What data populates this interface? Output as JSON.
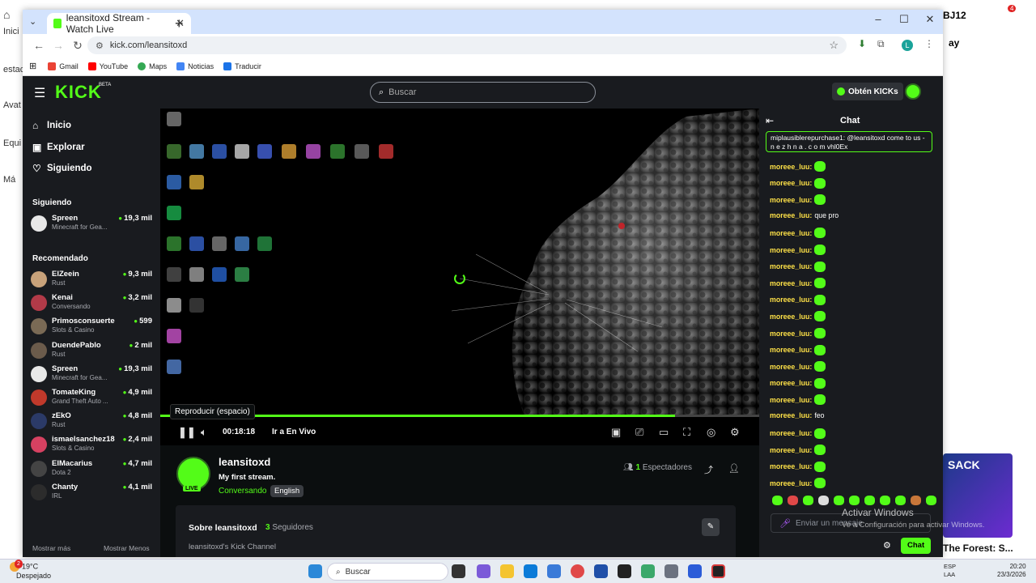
{
  "desktop": {
    "left_labels": [
      "Inici",
      "estac",
      "Avat",
      "Equi",
      "Má"
    ],
    "right_labels": [
      "BJ12",
      "ay"
    ],
    "notification_count": "4"
  },
  "browser": {
    "tab_title": "leansitoxd Stream - Watch Live",
    "url": "kick.com/leansitoxd",
    "bookmarks": [
      "Gmail",
      "YouTube",
      "Maps",
      "Noticias",
      "Traducir"
    ],
    "profile_letter": "L"
  },
  "kick": {
    "logo": "KICK",
    "beta": "BETA",
    "search_placeholder": "Buscar",
    "get_kicks": "Obtén KICKs",
    "nav": [
      "Inicio",
      "Explorar",
      "Siguiendo"
    ],
    "following_title": "Siguiendo",
    "following": [
      {
        "name": "Spreen",
        "category": "Minecraft for Gea...",
        "viewers": "19,3 mil"
      }
    ],
    "recommended_title": "Recomendado",
    "recommended": [
      {
        "name": "ElZeein",
        "category": "Rust",
        "viewers": "9,3 mil",
        "color": "#c8a27a"
      },
      {
        "name": "Kenai",
        "category": "Conversando",
        "viewers": "3,2 mil",
        "color": "#b23a48"
      },
      {
        "name": "Primosconsuerte",
        "category": "Slots & Casino",
        "viewers": "599",
        "color": "#7a6a55"
      },
      {
        "name": "DuendePablo",
        "category": "Rust",
        "viewers": "2 mil",
        "color": "#6b5b4b"
      },
      {
        "name": "Spreen",
        "category": "Minecraft for Gea...",
        "viewers": "19,3 mil",
        "color": "#e8e8e8"
      },
      {
        "name": "TomateKing",
        "category": "Grand Theft Auto ...",
        "viewers": "4,9 mil",
        "color": "#c0392b"
      },
      {
        "name": "zEkO",
        "category": "Rust",
        "viewers": "4,8 mil",
        "color": "#2b3a67"
      },
      {
        "name": "ismaelsanchez18",
        "category": "Slots & Casino",
        "viewers": "2,4 mil",
        "color": "#d64161"
      },
      {
        "name": "ElMacarius",
        "category": "Dota 2",
        "viewers": "4,7 mil",
        "color": "#444"
      },
      {
        "name": "Chanty",
        "category": "IRL",
        "viewers": "4,1 mil",
        "color": "#2c2c2c"
      }
    ],
    "show_more": "Mostrar más",
    "show_less": "Mostrar Menos"
  },
  "player": {
    "tooltip": "Reproducir (espacio)",
    "time": "00:18:18",
    "go_live": "Ir a En Vivo",
    "progress_fraction": 0.86
  },
  "channel": {
    "name": "leansitoxd",
    "live_badge": "LIVE",
    "title": "My first stream.",
    "category": "Conversando",
    "language": "English",
    "viewers_count": "1",
    "viewers_label": "Espectadores",
    "about_title": "Sobre leansitoxd",
    "followers_count": "3",
    "followers_label": "Seguidores",
    "description": "leansitoxd's Kick Channel"
  },
  "chat": {
    "title": "Chat",
    "pinned_text": "miplausiblerepurchase1: @leansitoxd come to us - n e z h n a . c o m vhl0Ex",
    "messages": [
      {
        "user": "moreee_luu:",
        "text": ""
      },
      {
        "user": "moreee_luu:",
        "text": ""
      },
      {
        "user": "moreee_luu:",
        "text": ""
      },
      {
        "user": "moreee_luu:",
        "text": "que pro"
      },
      {
        "user": "moreee_luu:",
        "text": ""
      },
      {
        "user": "moreee_luu:",
        "text": ""
      },
      {
        "user": "moreee_luu:",
        "text": ""
      },
      {
        "user": "moreee_luu:",
        "text": ""
      },
      {
        "user": "moreee_luu:",
        "text": ""
      },
      {
        "user": "moreee_luu:",
        "text": ""
      },
      {
        "user": "moreee_luu:",
        "text": ""
      },
      {
        "user": "moreee_luu:",
        "text": ""
      },
      {
        "user": "moreee_luu:",
        "text": ""
      },
      {
        "user": "moreee_luu:",
        "text": ""
      },
      {
        "user": "moreee_luu:",
        "text": ""
      },
      {
        "user": "moreee_luu:",
        "text": "feo"
      },
      {
        "user": "moreee_luu:",
        "text": ""
      },
      {
        "user": "moreee_luu:",
        "text": ""
      },
      {
        "user": "moreee_luu:",
        "text": ""
      },
      {
        "user": "moreee_luu:",
        "text": ""
      }
    ],
    "input_placeholder": "Enviar un mensaje",
    "send_label": "Chat"
  },
  "windows_watermark": {
    "line1": "Activar Windows",
    "line2": "Ve a Configuración para activar Windows."
  },
  "side_ad": {
    "text": "SACK",
    "caption": "The Forest: S..."
  },
  "taskbar": {
    "notif_badge": "2",
    "temperature": "19°C",
    "weather": "Despejado",
    "search_placeholder": "Buscar",
    "lang1": "ESP",
    "lang2": "LAA",
    "time": "20:20",
    "date": "23/3/2026"
  }
}
